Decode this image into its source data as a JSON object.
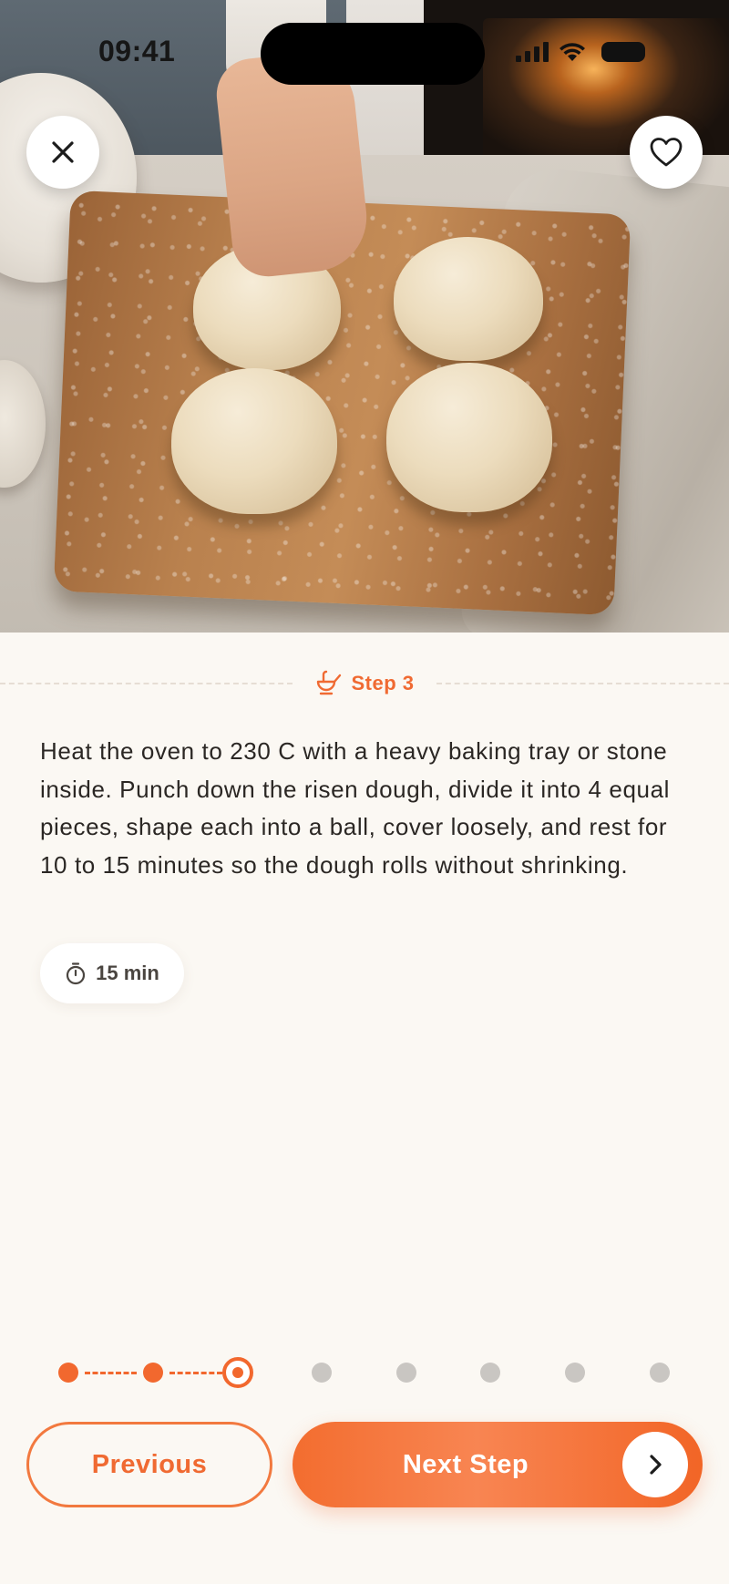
{
  "status_bar": {
    "time": "09:41"
  },
  "hero": {
    "image_icon": "dough-balls-photo"
  },
  "actions": {
    "close_icon": "close-icon",
    "favorite_icon": "heart-icon"
  },
  "step": {
    "label": "Step 3",
    "icon": "ladle-icon",
    "instruction": "Heat the oven to 230 C with a heavy baking tray or stone inside. Punch down the risen dough, divide it into 4 equal pieces, shape each into a ball, cover loosely, and rest for 10 to 15 minutes so the dough rolls without shrinking.",
    "time": "15 min",
    "time_icon": "timer-icon"
  },
  "progress": {
    "current": 3,
    "total": 8
  },
  "nav": {
    "previous_label": "Previous",
    "next_label": "Next Step",
    "next_icon": "chevron-right-icon"
  },
  "colors": {
    "accent": "#f2682e",
    "background": "#fbf8f3",
    "inactive_dot": "#c9c6c2"
  }
}
